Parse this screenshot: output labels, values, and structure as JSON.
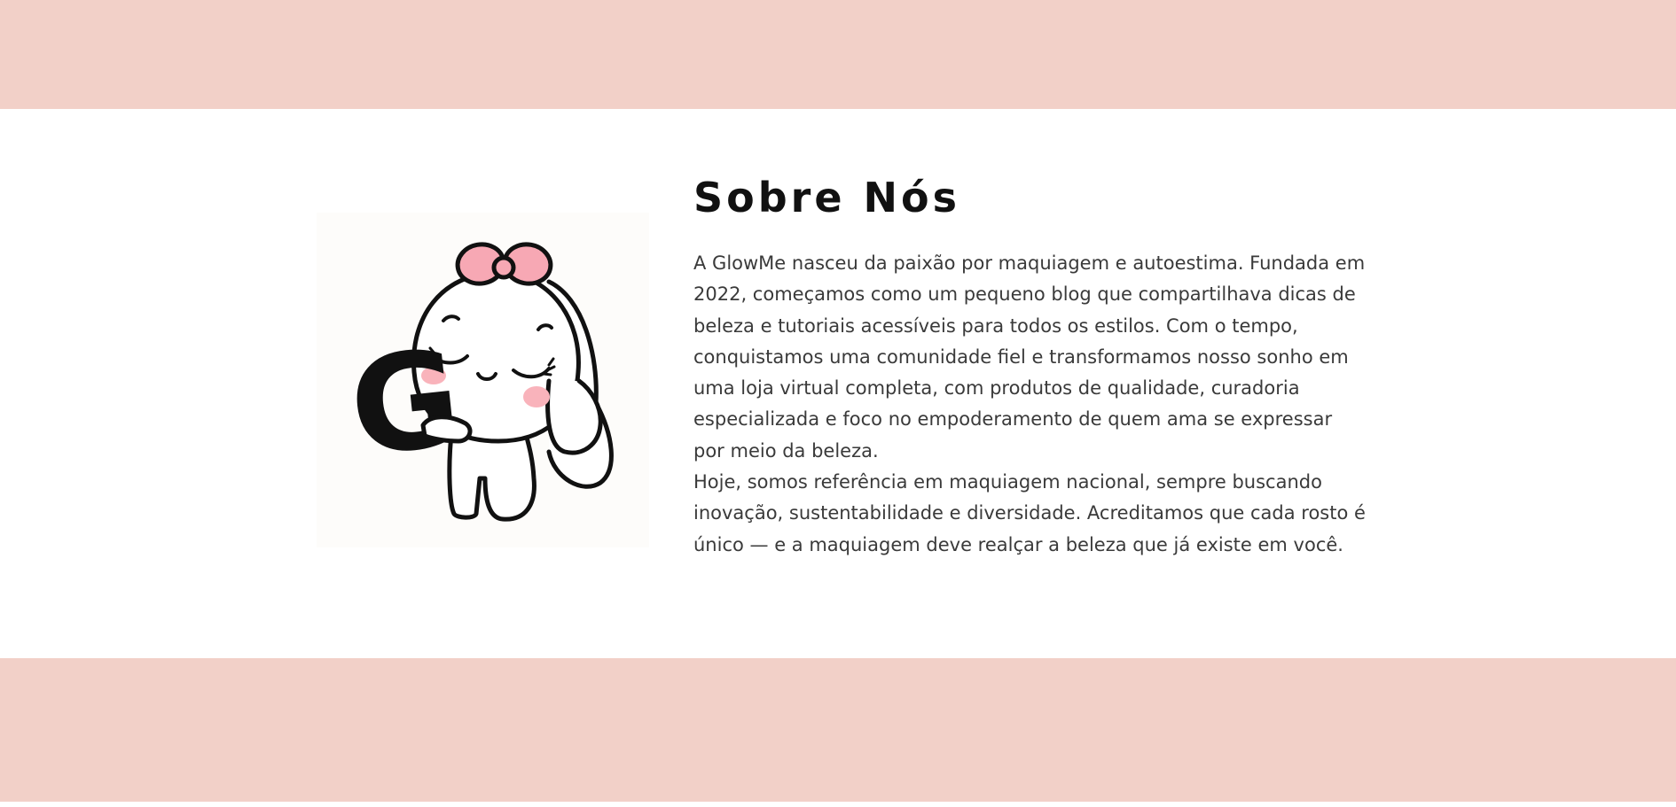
{
  "colors": {
    "band": "#f2d0c8",
    "background": "#ffffff",
    "title": "#111111",
    "text": "#3a3a3a",
    "bow": "#f7a8b4",
    "blush": "#f9b3bb"
  },
  "about": {
    "title": "Sobre Nós",
    "paragraphs": [
      "A GlowMe nasceu da paixão por maquiagem e autoestima. Fundada em 2022, começamos como um pequeno blog que compartilhava dicas de beleza e tutoriais acessíveis para todos os estilos. Com o tempo, conquistamos uma comunidade fiel e transformamos nosso sonho em uma loja virtual completa, com produtos de qualidade, curadoria especializada e foco no empoderamento de quem ama se expressar por meio da beleza.",
      "Hoje, somos referência em maquiagem nacional, sempre buscando inovação, sustentabilidade e diversidade. Acreditamos que cada rosto é único — e a maquiagem deve realçar a beleza que já existe em você."
    ],
    "mascot": {
      "icon": "bunny-mascot-holding-letter-g-icon",
      "letter": "G"
    }
  }
}
